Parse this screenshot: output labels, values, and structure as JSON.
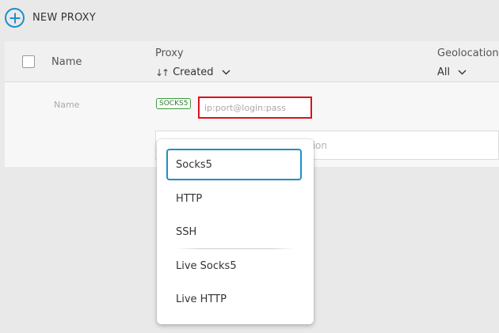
{
  "toolbar": {
    "new_proxy_label": "NEW PROXY"
  },
  "table": {
    "headers": {
      "name": "Name",
      "proxy": "Proxy",
      "sort_label": "Created",
      "sort_icon": "↓↑",
      "geolocation": "Geolocation",
      "geo_filter": "All"
    },
    "new_row": {
      "name_placeholder": "Name",
      "proxy_type_badge": "SOCKS5",
      "proxy_placeholder": "ip:port@login:pass",
      "geo_placeholder_visible": "ation"
    }
  },
  "dropdown": {
    "options": [
      {
        "label": "Socks5",
        "selected": true
      },
      {
        "label": "HTTP",
        "selected": false
      },
      {
        "label": "SSH",
        "selected": false
      },
      {
        "label": "Live Socks5",
        "selected": false
      },
      {
        "label": "Live HTTP",
        "selected": false
      }
    ]
  },
  "colors": {
    "accent": "#1e8fc9",
    "highlight_border": "#e0101c",
    "badge_green": "#3a9a3a"
  }
}
